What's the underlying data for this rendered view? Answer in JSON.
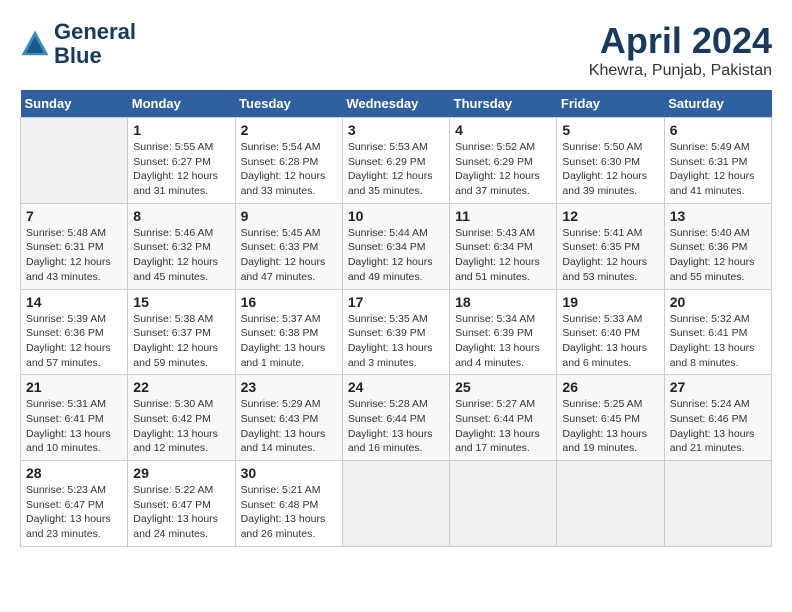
{
  "logo": {
    "line1": "General",
    "line2": "Blue"
  },
  "title": "April 2024",
  "subtitle": "Khewra, Punjab, Pakistan",
  "days_header": [
    "Sunday",
    "Monday",
    "Tuesday",
    "Wednesday",
    "Thursday",
    "Friday",
    "Saturday"
  ],
  "weeks": [
    [
      {
        "day": "",
        "sunrise": "",
        "sunset": "",
        "daylight": ""
      },
      {
        "day": "1",
        "sunrise": "Sunrise: 5:55 AM",
        "sunset": "Sunset: 6:27 PM",
        "daylight": "Daylight: 12 hours and 31 minutes."
      },
      {
        "day": "2",
        "sunrise": "Sunrise: 5:54 AM",
        "sunset": "Sunset: 6:28 PM",
        "daylight": "Daylight: 12 hours and 33 minutes."
      },
      {
        "day": "3",
        "sunrise": "Sunrise: 5:53 AM",
        "sunset": "Sunset: 6:29 PM",
        "daylight": "Daylight: 12 hours and 35 minutes."
      },
      {
        "day": "4",
        "sunrise": "Sunrise: 5:52 AM",
        "sunset": "Sunset: 6:29 PM",
        "daylight": "Daylight: 12 hours and 37 minutes."
      },
      {
        "day": "5",
        "sunrise": "Sunrise: 5:50 AM",
        "sunset": "Sunset: 6:30 PM",
        "daylight": "Daylight: 12 hours and 39 minutes."
      },
      {
        "day": "6",
        "sunrise": "Sunrise: 5:49 AM",
        "sunset": "Sunset: 6:31 PM",
        "daylight": "Daylight: 12 hours and 41 minutes."
      }
    ],
    [
      {
        "day": "7",
        "sunrise": "Sunrise: 5:48 AM",
        "sunset": "Sunset: 6:31 PM",
        "daylight": "Daylight: 12 hours and 43 minutes."
      },
      {
        "day": "8",
        "sunrise": "Sunrise: 5:46 AM",
        "sunset": "Sunset: 6:32 PM",
        "daylight": "Daylight: 12 hours and 45 minutes."
      },
      {
        "day": "9",
        "sunrise": "Sunrise: 5:45 AM",
        "sunset": "Sunset: 6:33 PM",
        "daylight": "Daylight: 12 hours and 47 minutes."
      },
      {
        "day": "10",
        "sunrise": "Sunrise: 5:44 AM",
        "sunset": "Sunset: 6:34 PM",
        "daylight": "Daylight: 12 hours and 49 minutes."
      },
      {
        "day": "11",
        "sunrise": "Sunrise: 5:43 AM",
        "sunset": "Sunset: 6:34 PM",
        "daylight": "Daylight: 12 hours and 51 minutes."
      },
      {
        "day": "12",
        "sunrise": "Sunrise: 5:41 AM",
        "sunset": "Sunset: 6:35 PM",
        "daylight": "Daylight: 12 hours and 53 minutes."
      },
      {
        "day": "13",
        "sunrise": "Sunrise: 5:40 AM",
        "sunset": "Sunset: 6:36 PM",
        "daylight": "Daylight: 12 hours and 55 minutes."
      }
    ],
    [
      {
        "day": "14",
        "sunrise": "Sunrise: 5:39 AM",
        "sunset": "Sunset: 6:36 PM",
        "daylight": "Daylight: 12 hours and 57 minutes."
      },
      {
        "day": "15",
        "sunrise": "Sunrise: 5:38 AM",
        "sunset": "Sunset: 6:37 PM",
        "daylight": "Daylight: 12 hours and 59 minutes."
      },
      {
        "day": "16",
        "sunrise": "Sunrise: 5:37 AM",
        "sunset": "Sunset: 6:38 PM",
        "daylight": "Daylight: 13 hours and 1 minute."
      },
      {
        "day": "17",
        "sunrise": "Sunrise: 5:35 AM",
        "sunset": "Sunset: 6:39 PM",
        "daylight": "Daylight: 13 hours and 3 minutes."
      },
      {
        "day": "18",
        "sunrise": "Sunrise: 5:34 AM",
        "sunset": "Sunset: 6:39 PM",
        "daylight": "Daylight: 13 hours and 4 minutes."
      },
      {
        "day": "19",
        "sunrise": "Sunrise: 5:33 AM",
        "sunset": "Sunset: 6:40 PM",
        "daylight": "Daylight: 13 hours and 6 minutes."
      },
      {
        "day": "20",
        "sunrise": "Sunrise: 5:32 AM",
        "sunset": "Sunset: 6:41 PM",
        "daylight": "Daylight: 13 hours and 8 minutes."
      }
    ],
    [
      {
        "day": "21",
        "sunrise": "Sunrise: 5:31 AM",
        "sunset": "Sunset: 6:41 PM",
        "daylight": "Daylight: 13 hours and 10 minutes."
      },
      {
        "day": "22",
        "sunrise": "Sunrise: 5:30 AM",
        "sunset": "Sunset: 6:42 PM",
        "daylight": "Daylight: 13 hours and 12 minutes."
      },
      {
        "day": "23",
        "sunrise": "Sunrise: 5:29 AM",
        "sunset": "Sunset: 6:43 PM",
        "daylight": "Daylight: 13 hours and 14 minutes."
      },
      {
        "day": "24",
        "sunrise": "Sunrise: 5:28 AM",
        "sunset": "Sunset: 6:44 PM",
        "daylight": "Daylight: 13 hours and 16 minutes."
      },
      {
        "day": "25",
        "sunrise": "Sunrise: 5:27 AM",
        "sunset": "Sunset: 6:44 PM",
        "daylight": "Daylight: 13 hours and 17 minutes."
      },
      {
        "day": "26",
        "sunrise": "Sunrise: 5:25 AM",
        "sunset": "Sunset: 6:45 PM",
        "daylight": "Daylight: 13 hours and 19 minutes."
      },
      {
        "day": "27",
        "sunrise": "Sunrise: 5:24 AM",
        "sunset": "Sunset: 6:46 PM",
        "daylight": "Daylight: 13 hours and 21 minutes."
      }
    ],
    [
      {
        "day": "28",
        "sunrise": "Sunrise: 5:23 AM",
        "sunset": "Sunset: 6:47 PM",
        "daylight": "Daylight: 13 hours and 23 minutes."
      },
      {
        "day": "29",
        "sunrise": "Sunrise: 5:22 AM",
        "sunset": "Sunset: 6:47 PM",
        "daylight": "Daylight: 13 hours and 24 minutes."
      },
      {
        "day": "30",
        "sunrise": "Sunrise: 5:21 AM",
        "sunset": "Sunset: 6:48 PM",
        "daylight": "Daylight: 13 hours and 26 minutes."
      },
      {
        "day": "",
        "sunrise": "",
        "sunset": "",
        "daylight": ""
      },
      {
        "day": "",
        "sunrise": "",
        "sunset": "",
        "daylight": ""
      },
      {
        "day": "",
        "sunrise": "",
        "sunset": "",
        "daylight": ""
      },
      {
        "day": "",
        "sunrise": "",
        "sunset": "",
        "daylight": ""
      }
    ]
  ]
}
